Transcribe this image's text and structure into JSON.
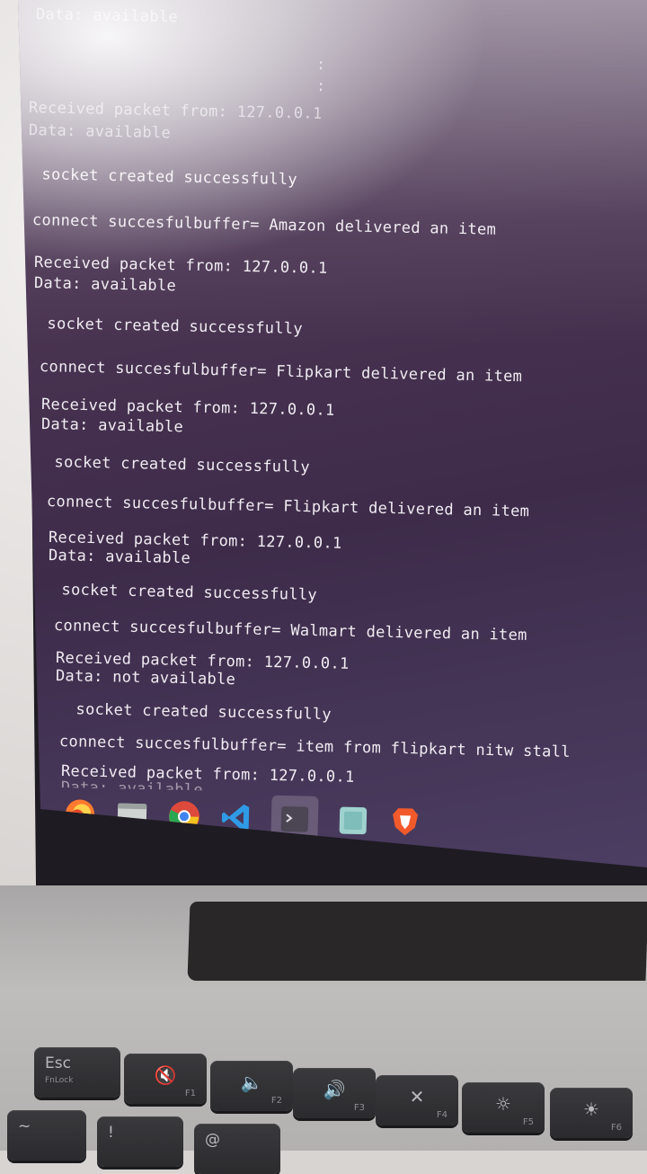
{
  "terminal": {
    "lines": [
      "Data: available",
      ":",
      ":",
      "Received packet from: 127.0.0.1",
      "Data: available",
      " socket created successfully",
      "connect succesfulbuffer= Amazon delivered an item",
      "Received packet from: 127.0.0.1",
      "Data: available",
      " socket created successfully",
      "connect succesfulbuffer= Flipkart delivered an item",
      "Received packet from: 127.0.0.1",
      "Data: available",
      " socket created successfully",
      "connect succesfulbuffer= Flipkart delivered an item",
      "Received packet from: 127.0.0.1",
      "Data: available",
      " socket created successfully",
      "connect succesfulbuffer= Walmart delivered an item",
      "Received packet from: 127.0.0.1",
      "Data: not available",
      " socket created successfully",
      "connect succesfulbuffer= item from flipkart nitw stall",
      "Received packet from: 127.0.0.1",
      "Data: available"
    ]
  },
  "dock": {
    "items": [
      {
        "icon": "firefox-icon"
      },
      {
        "icon": "files-icon"
      },
      {
        "icon": "chrome-icon"
      },
      {
        "icon": "vscode-icon"
      },
      {
        "icon": "terminal-icon"
      },
      {
        "icon": "text-editor-icon"
      },
      {
        "icon": "brave-icon"
      }
    ]
  },
  "keyboard": {
    "esc": {
      "label": "Esc",
      "sub": "FnLock"
    },
    "f1": {
      "fn": "F1"
    },
    "f2": {
      "fn": "F2"
    },
    "f3": {
      "fn": "F3"
    },
    "f4": {
      "fn": "F4"
    },
    "f5": {
      "fn": "F5"
    },
    "f6": {
      "fn": "F6"
    },
    "tilde": {
      "label": "~"
    },
    "one": {
      "label": "!"
    },
    "two": {
      "label": "@"
    }
  },
  "colors": {
    "terminal_bg": "#45304f",
    "terminal_text": "#f0ecf2",
    "keyboard_key": "#2f2f32",
    "laptop_body": "#b5b3b2"
  }
}
